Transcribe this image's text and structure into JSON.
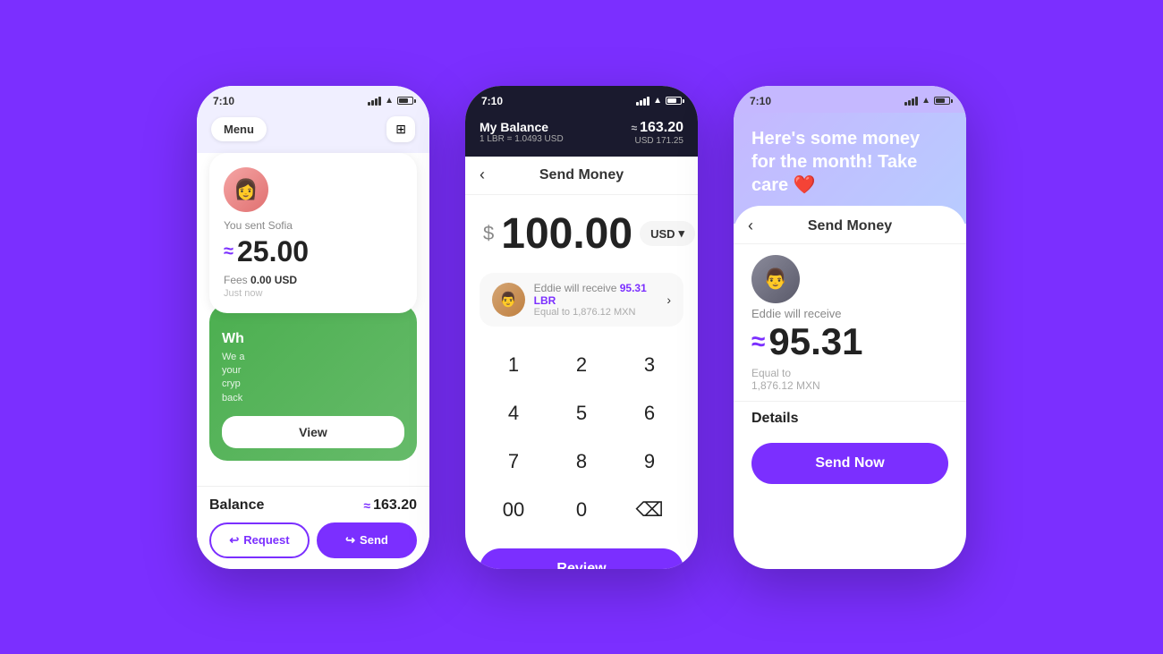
{
  "background": "#7B2FFF",
  "phone1": {
    "status": {
      "time": "7:10",
      "signal": true,
      "wifi": true,
      "battery": true
    },
    "header": {
      "menu_label": "Menu",
      "qr_label": "⊞"
    },
    "transaction": {
      "sent_label": "You sent Sofia",
      "amount": "25.00",
      "fees_label": "Fees",
      "fees_value": "0.00 USD",
      "time_label": "Just now"
    },
    "promo": {
      "title": "Wh",
      "text_line1": "We a",
      "text_line2": "your",
      "text_line3": "cryp",
      "text_line4": "back"
    },
    "view_button": "View",
    "footer": {
      "balance_label": "Balance",
      "balance_amount": "163.20",
      "request_label": "Request",
      "send_label": "Send"
    }
  },
  "phone2": {
    "status": {
      "time": "7:10",
      "signal": true,
      "wifi": true,
      "battery": true
    },
    "header": {
      "my_balance": "My Balance",
      "exchange_rate": "1 LBR = 1.0493 USD",
      "lbr_amount": "163.20",
      "usd_amount": "USD 171.25"
    },
    "send_money_title": "Send Money",
    "amount": "100.00",
    "currency": "USD",
    "recipient": {
      "name_pre": "Eddie will receive",
      "amount": "95.31 LBR",
      "conversion": "Equal to 1,876.12 MXN"
    },
    "numpad": [
      "1",
      "2",
      "3",
      "4",
      "5",
      "6",
      "7",
      "8",
      "9",
      "00",
      "0",
      "⌫"
    ],
    "review_button": "Review"
  },
  "phone3": {
    "status": {
      "time": "7:10",
      "signal": true,
      "wifi": true,
      "battery": true
    },
    "banner": {
      "text": "Here's some money for the month! Take care ❤️"
    },
    "send_money_title": "Send Money",
    "recipient_name": "Eddie will receive",
    "receive_amount": "95.31",
    "equal_to": "Equal to",
    "mxn_value": "1,876.12 MXN",
    "details_label": "Details",
    "send_now_button": "Send Now"
  }
}
